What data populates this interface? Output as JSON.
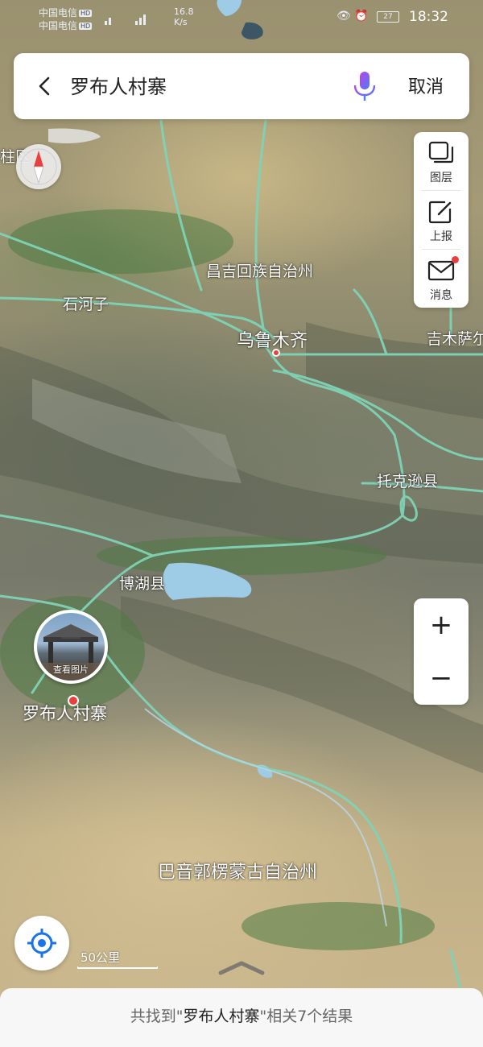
{
  "status_bar": {
    "carrier_1": "中国电信",
    "carrier_2": "中国电信",
    "hd_badge": "HD",
    "net_speed_value": "16.8",
    "net_speed_unit": "K/s",
    "battery": "27",
    "time": "18:32"
  },
  "search": {
    "query": "罗布人村寨",
    "cancel_label": "取消",
    "back_icon": "chevron-left-icon",
    "mic_icon": "microphone-icon"
  },
  "map_tools": {
    "layers_label": "图层",
    "report_label": "上报",
    "messages_label": "消息"
  },
  "zoom": {
    "in_label": "+",
    "out_label": "−"
  },
  "scale": {
    "label": "50公里"
  },
  "map_labels": {
    "edge_left": "柱区",
    "changji": "昌吉回族自治州",
    "shihezi": "石河子",
    "urumqi": "乌鲁木齐",
    "jimsar": "吉木萨尔",
    "toksun": "托克逊县",
    "bohu": "博湖县",
    "bayingolin": "巴音郭楞蒙古自治州"
  },
  "poi": {
    "photo_label": "查看图片",
    "name": "罗布人村寨"
  },
  "result": {
    "prefix": "共找到\"",
    "query": "罗布人村寨",
    "suffix": "\"相关7个结果"
  },
  "colors": {
    "road": "#7fd3b7",
    "accent_blue": "#1a73e8",
    "alert_red": "#e8413d",
    "lake": "#9ecbe6"
  }
}
